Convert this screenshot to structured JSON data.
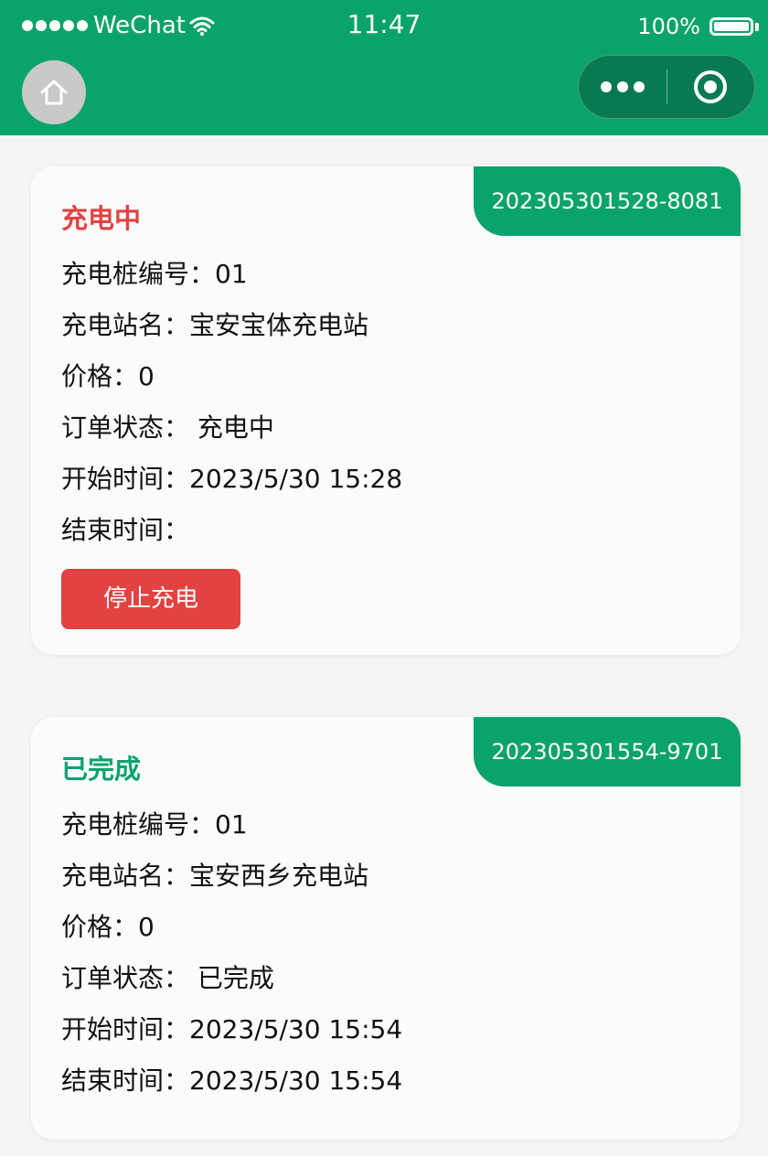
{
  "status_bar": {
    "carrier": "WeChat",
    "time": "11:47",
    "battery": "100%"
  },
  "colors": {
    "brand_green": "#0aa36b",
    "status_red": "#e24242",
    "background": "#f5f5f5"
  },
  "nav": {
    "home_icon": "home-icon",
    "more_icon": "more-dots-icon",
    "close_icon": "target-close-icon"
  },
  "orders": [
    {
      "order_no": "202305301528-8081",
      "status_title": "充电中",
      "status_color": "#e24242",
      "pile_line": "充电桩编号：01",
      "station_line": "充电站名：宝安宝体充电站",
      "price_line": "价格：0",
      "order_status_line": "订单状态： 充电中",
      "start_line": "开始时间：2023/5/30 15:28",
      "end_line": "结束时间：",
      "action_label": "停止充电"
    },
    {
      "order_no": "202305301554-9701",
      "status_title": "已完成",
      "status_color": "#0aa36b",
      "pile_line": "充电桩编号：01",
      "station_line": "充电站名：宝安西乡充电站",
      "price_line": "价格：0",
      "order_status_line": "订单状态： 已完成",
      "start_line": "开始时间：2023/5/30 15:54",
      "end_line": "结束时间：2023/5/30 15:54"
    }
  ]
}
